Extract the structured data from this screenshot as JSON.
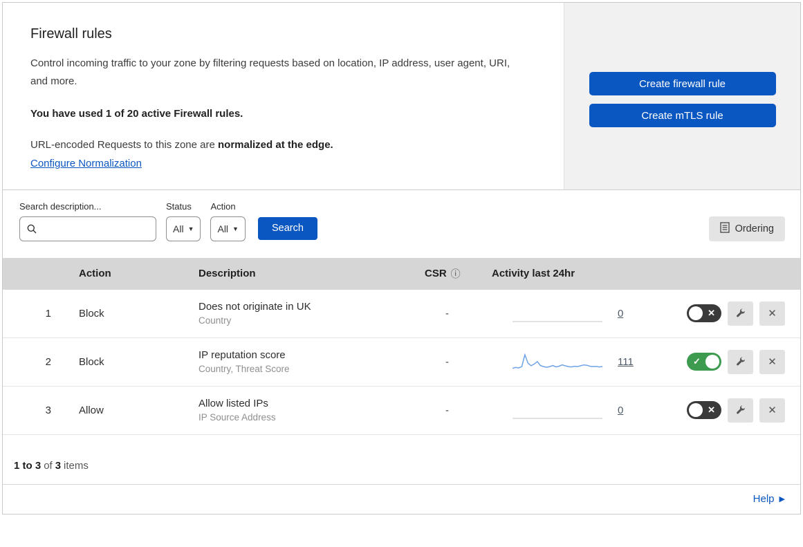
{
  "colors": {
    "primary_blue": "#0b57c2",
    "toggle_on": "#3d9b50",
    "toggle_off": "#3a3a3a",
    "spark_line": "#6ea3e8",
    "spark_flat": "#d8d8d8"
  },
  "icons": {
    "chevron_down": "▼",
    "info": "ⓘ",
    "close": "✕",
    "check": "✓",
    "cross": "✕",
    "help_arrow": "▶"
  },
  "header": {
    "title": "Firewall rules",
    "description": "Control incoming traffic to your zone by filtering requests based on location, IP address, user agent, URI, and more.",
    "usage": "You have used 1 of 20 active Firewall rules.",
    "normalization_prefix": "URL-encoded Requests to this zone are ",
    "normalization_bold": "normalized at the edge.",
    "configure_link": "Configure Normalization",
    "create_firewall_button": "Create firewall rule",
    "create_mtls_button": "Create mTLS rule"
  },
  "filters": {
    "search_label": "Search description...",
    "status_label": "Status",
    "status_value": "All",
    "action_label": "Action",
    "action_value": "All",
    "search_button": "Search",
    "ordering_button": "Ordering"
  },
  "table": {
    "columns": {
      "action": "Action",
      "description": "Description",
      "csr": "CSR",
      "activity": "Activity last 24hr"
    },
    "rows": [
      {
        "index": "1",
        "action": "Block",
        "description": "Does not originate in UK",
        "subtext": "Country",
        "csr": "-",
        "activity_count": "0",
        "enabled": false,
        "sparkline": [
          0,
          0,
          0
        ]
      },
      {
        "index": "2",
        "action": "Block",
        "description": "IP reputation score",
        "subtext": "Country, Threat Score",
        "csr": "-",
        "activity_count": "111",
        "enabled": true,
        "sparkline": [
          1,
          1.5,
          1.2,
          2,
          9,
          4,
          2.5,
          3.5,
          5,
          2.6,
          2,
          1.6,
          2,
          2.6,
          1.8,
          2.2,
          3,
          2.5,
          2,
          1.8,
          2.2,
          2,
          2.5,
          3,
          2.8,
          2.2,
          2,
          2.1,
          1.8,
          2
        ]
      },
      {
        "index": "3",
        "action": "Allow",
        "description": "Allow listed IPs",
        "subtext": "IP Source Address",
        "csr": "-",
        "activity_count": "0",
        "enabled": false,
        "sparkline": [
          0,
          0,
          0
        ]
      }
    ]
  },
  "footer": {
    "range": "1 to 3",
    "of": "of",
    "total": "3",
    "items_label": "items",
    "help_label": "Help"
  }
}
